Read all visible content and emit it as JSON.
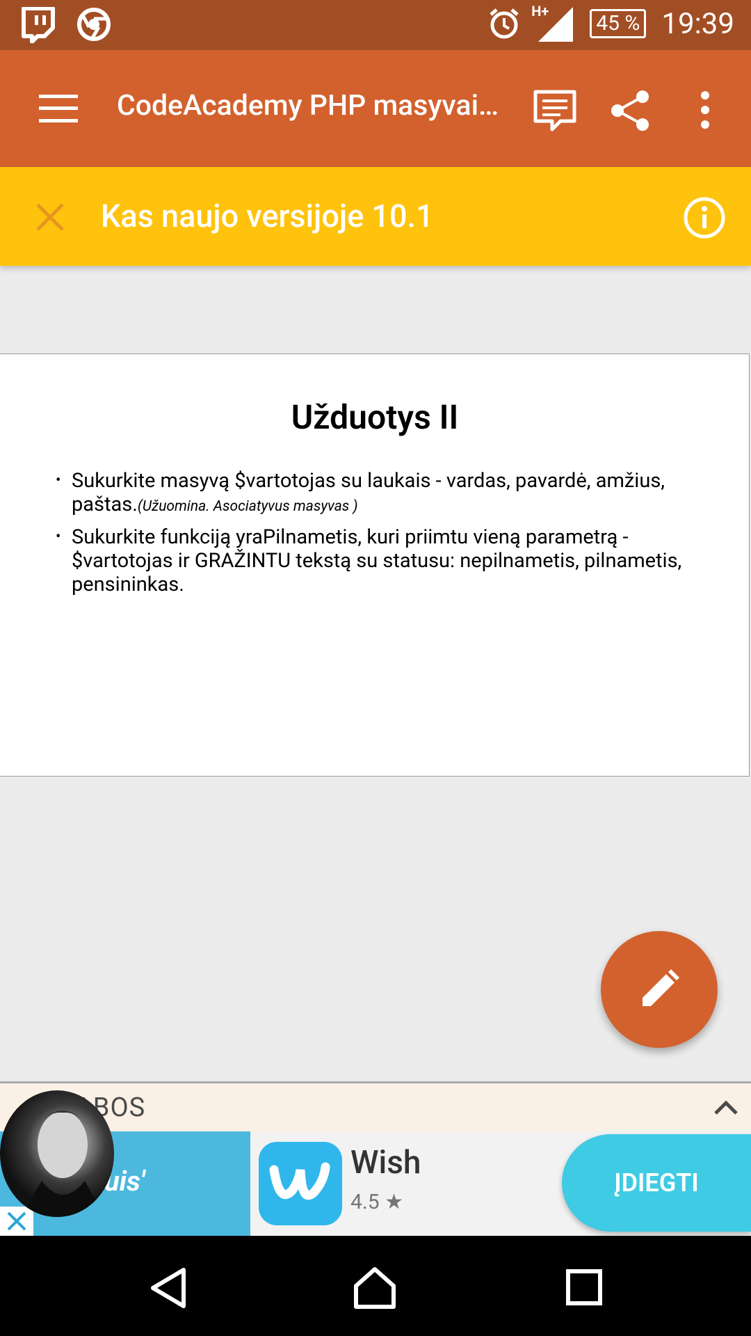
{
  "status_bar": {
    "time": "19:39",
    "battery": "45 %",
    "network": "H+",
    "icons": [
      "twitch-icon",
      "chrome-icon",
      "alarm-icon",
      "signal-icon",
      "battery-icon"
    ]
  },
  "app_bar": {
    "title": "CodeAcademy PHP masyvai…",
    "icons": [
      "menu-icon",
      "comments-icon",
      "share-icon",
      "more-vert-icon"
    ]
  },
  "banner": {
    "text": "Kas naujo versijoje 10.1",
    "icons": [
      "close-icon",
      "info-icon"
    ]
  },
  "slide": {
    "title": "Užduotys II",
    "bullets": [
      {
        "text": "Sukurkite masyvą $vartotojas su laukais - vardas, pavardė, amžius, paštas.",
        "note": "(Užuomina. Asociatyvus masyvas )"
      },
      {
        "text": "Sukurkite funkciją yraPilnametis, kuri priimtu vieną parametrą - $vartotojas ir GRAŽINTU tekstą su statusu: nepilnametis, pilnametis, pensininkas.",
        "note": ""
      }
    ]
  },
  "fab": {
    "icon": "edit-pencil-icon"
  },
  "tabs_bar": {
    "label": "ABOS",
    "icon": "chevron-up-icon"
  },
  "ad": {
    "left_text": "uis'",
    "app_name": "Wish",
    "rating": "4.5",
    "install_label": "ĮDIEGTI",
    "icons": [
      "wish-logo-icon",
      "star-icon",
      "ad-close-icon"
    ]
  },
  "nav_bar": {
    "icons": [
      "back-icon",
      "home-icon",
      "recents-icon"
    ]
  },
  "colors": {
    "status_bar": "#a24e25",
    "app_bar": "#d2612e",
    "banner": "#ffc30d",
    "fab": "#d2612e",
    "install_button": "#3fcbe3"
  }
}
